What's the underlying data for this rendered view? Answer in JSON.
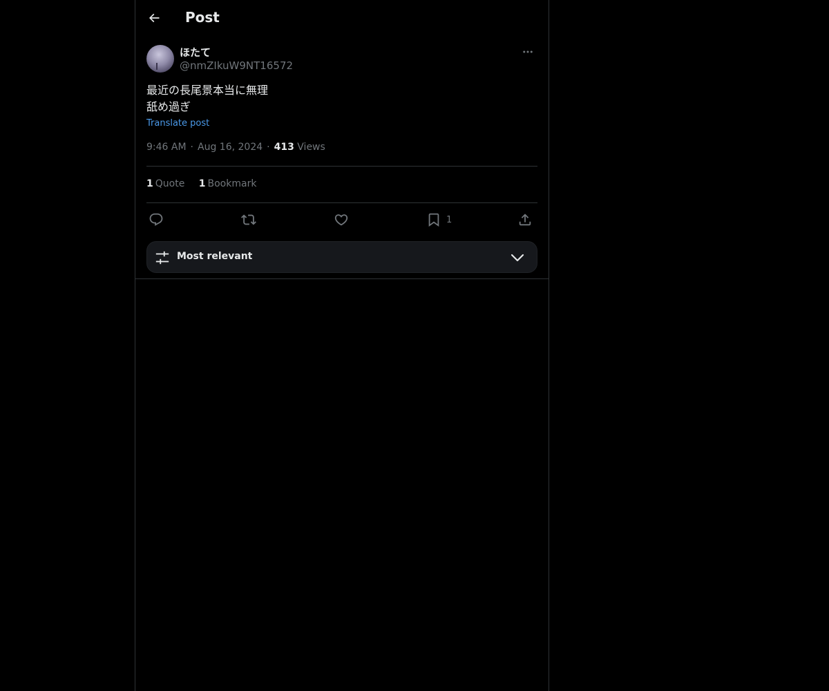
{
  "header": {
    "title": "Post",
    "back_icon": "arrow-left-icon"
  },
  "author": {
    "display_name": "ほたて",
    "handle": "@nmZIkuW9NT16572"
  },
  "tweet": {
    "lines": [
      "最近の長尾景本当に無理",
      "舐め過ぎ"
    ],
    "translate_label": "Translate post"
  },
  "meta": {
    "time": "9:46 AM",
    "date": "Aug 16, 2024",
    "views_count": "413",
    "views_label": "Views",
    "separator": "·"
  },
  "stats": {
    "quotes_count": "1",
    "quotes_label": "Quote",
    "bookmarks_count": "1",
    "bookmarks_label": "Bookmark"
  },
  "actions": {
    "bookmark_count": "1"
  },
  "sort": {
    "label": "Most relevant"
  },
  "colors": {
    "background": "#000000",
    "text_primary": "#e7e9ea",
    "text_secondary": "#71767b",
    "link": "#4a99e9",
    "divider": "#2f3336"
  }
}
